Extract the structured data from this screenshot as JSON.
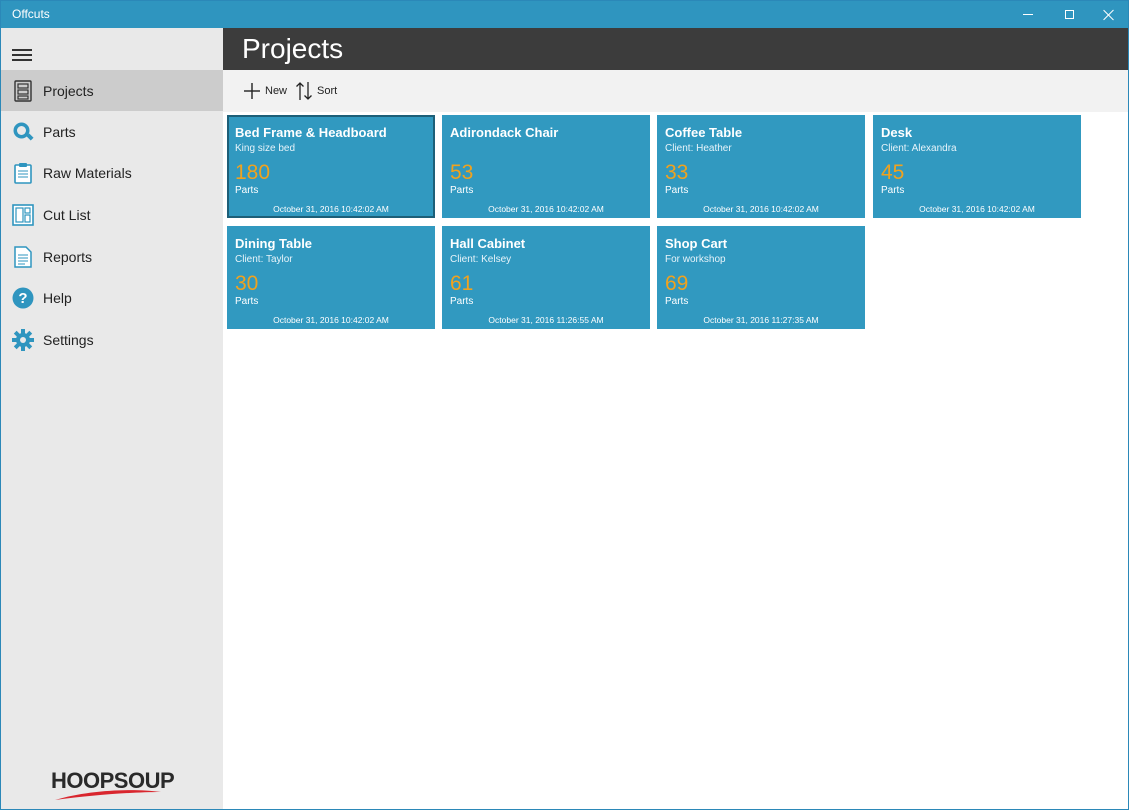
{
  "app": {
    "title": "Offcuts"
  },
  "header": {
    "title": "Projects"
  },
  "commands": {
    "new_label": "New",
    "sort_label": "Sort"
  },
  "sidebar": {
    "items": [
      {
        "label": "Projects",
        "icon": "cabinet-icon",
        "active": true
      },
      {
        "label": "Parts",
        "icon": "search-icon",
        "active": false
      },
      {
        "label": "Raw Materials",
        "icon": "clipboard-icon",
        "active": false
      },
      {
        "label": "Cut List",
        "icon": "layout-icon",
        "active": false
      },
      {
        "label": "Reports",
        "icon": "document-icon",
        "active": false
      },
      {
        "label": "Help",
        "icon": "help-icon",
        "active": false
      },
      {
        "label": "Settings",
        "icon": "gear-icon",
        "active": false
      }
    ],
    "logo_text": "HOOPSOUP"
  },
  "projects": [
    {
      "name": "Bed Frame & Headboard",
      "description": "King size bed",
      "count": "180",
      "unit": "Parts",
      "date": "October 31, 2016 10:42:02 AM",
      "selected": true
    },
    {
      "name": "Adirondack Chair",
      "description": "",
      "count": "53",
      "unit": "Parts",
      "date": "October 31, 2016 10:42:02 AM"
    },
    {
      "name": "Coffee Table",
      "description": "Client: Heather",
      "count": "33",
      "unit": "Parts",
      "date": "October 31, 2016 10:42:02 AM"
    },
    {
      "name": "Desk",
      "description": "Client: Alexandra",
      "count": "45",
      "unit": "Parts",
      "date": "October 31, 2016 10:42:02 AM"
    },
    {
      "name": "Dining Table",
      "description": "Client: Taylor",
      "count": "30",
      "unit": "Parts",
      "date": "October 31, 2016 10:42:02 AM"
    },
    {
      "name": "Hall Cabinet",
      "description": "Client: Kelsey",
      "count": "61",
      "unit": "Parts",
      "date": "October 31, 2016 11:26:55 AM"
    },
    {
      "name": "Shop Cart",
      "description": "For workshop",
      "count": "69",
      "unit": "Parts",
      "date": "October 31, 2016 11:27:35 AM"
    }
  ],
  "colors": {
    "titlebar": "#2f95bf",
    "tile": "#3199c0",
    "count": "#f0a21e",
    "header": "#3c3c3c",
    "sidebar": "#e9e9e9",
    "sidebar_active": "#cccccc"
  }
}
